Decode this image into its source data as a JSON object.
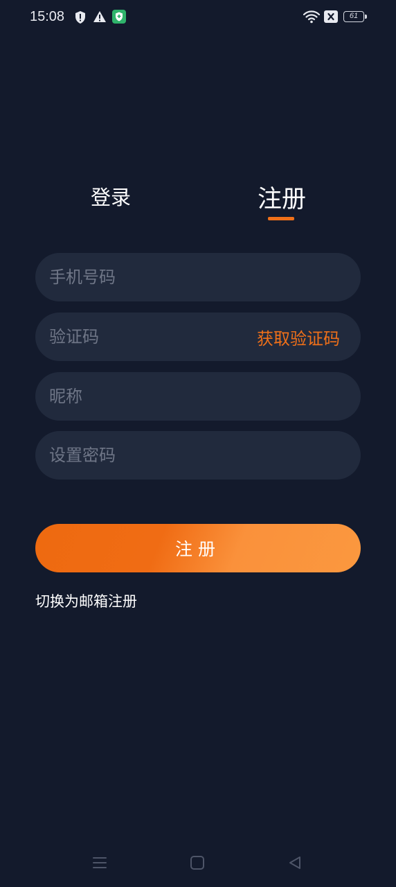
{
  "status_bar": {
    "time": "15:08",
    "battery_level": "61",
    "icons": [
      "shield-alert-icon",
      "warning-icon",
      "vpn-shield-icon",
      "wifi-icon",
      "no-sim-icon",
      "battery-icon"
    ]
  },
  "tabs": {
    "login_label": "登录",
    "register_label": "注册",
    "active": "register"
  },
  "form": {
    "phone_placeholder": "手机号码",
    "code_placeholder": "验证码",
    "get_code_label": "获取验证码",
    "nickname_placeholder": "昵称",
    "password_placeholder": "设置密码",
    "submit_label": "注册",
    "switch_label": "切换为邮箱注册"
  },
  "nav_bar": {
    "icons": [
      "menu-icon",
      "home-icon",
      "back-icon"
    ]
  },
  "colors": {
    "background": "#131a2c",
    "field_background": "#212a3d",
    "accent": "#f07019"
  }
}
